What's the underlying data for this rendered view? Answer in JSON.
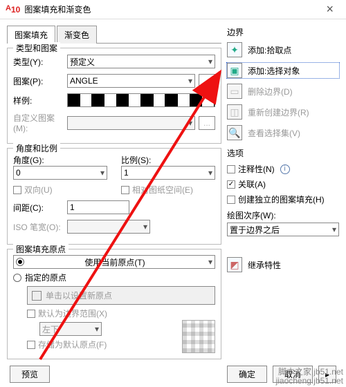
{
  "window": {
    "title": "图案填充和渐变色"
  },
  "tabs": {
    "hatch": "图案填充",
    "grad": "渐变色"
  },
  "typepat": {
    "title": "类型和图案",
    "type_l": "类型(Y):",
    "type_v": "预定义",
    "pat_l": "图案(P):",
    "pat_v": "ANGLE",
    "dots": "...",
    "sample_l": "样例:",
    "custom_l": "自定义图案(M):"
  },
  "angsc": {
    "title": "角度和比例",
    "ang_l": "角度(G):",
    "ang_v": "0",
    "sc_l": "比例(S):",
    "sc_v": "1",
    "bidi": "双向(U)",
    "rel": "相对图纸空间(E)",
    "gap_l": "间距(C):",
    "gap_v": "1",
    "iso_l": "ISO 笔宽(O):"
  },
  "origin": {
    "title": "图案填充原点",
    "use_cur": "使用当前原点(T)",
    "spec": "指定的原点",
    "click_set": "单击以设置新原点",
    "def_ext": "默认为边界范围(X)",
    "ext_v": "左下",
    "store": "存储为默认原点(F)"
  },
  "boundary": {
    "title": "边界",
    "add_pick": "添加:拾取点",
    "add_sel": "添加:选择对象",
    "del": "删除边界(D)",
    "recreate": "重新创建边界(R)",
    "view": "查看选择集(V)"
  },
  "opts": {
    "title": "选项",
    "anno": "注释性(N)",
    "assoc": "关联(A)",
    "indep": "创建独立的图案填充(H)",
    "order_l": "绘图次序(W):",
    "order_v": "置于边界之后"
  },
  "inherit": "继承特性",
  "btns": {
    "preview": "预览",
    "ok": "确定",
    "cancel": "取消"
  },
  "wm": {
    "l1": "脚本之家.jb51.net",
    "l2": "jiaocheng.jb51.net"
  }
}
